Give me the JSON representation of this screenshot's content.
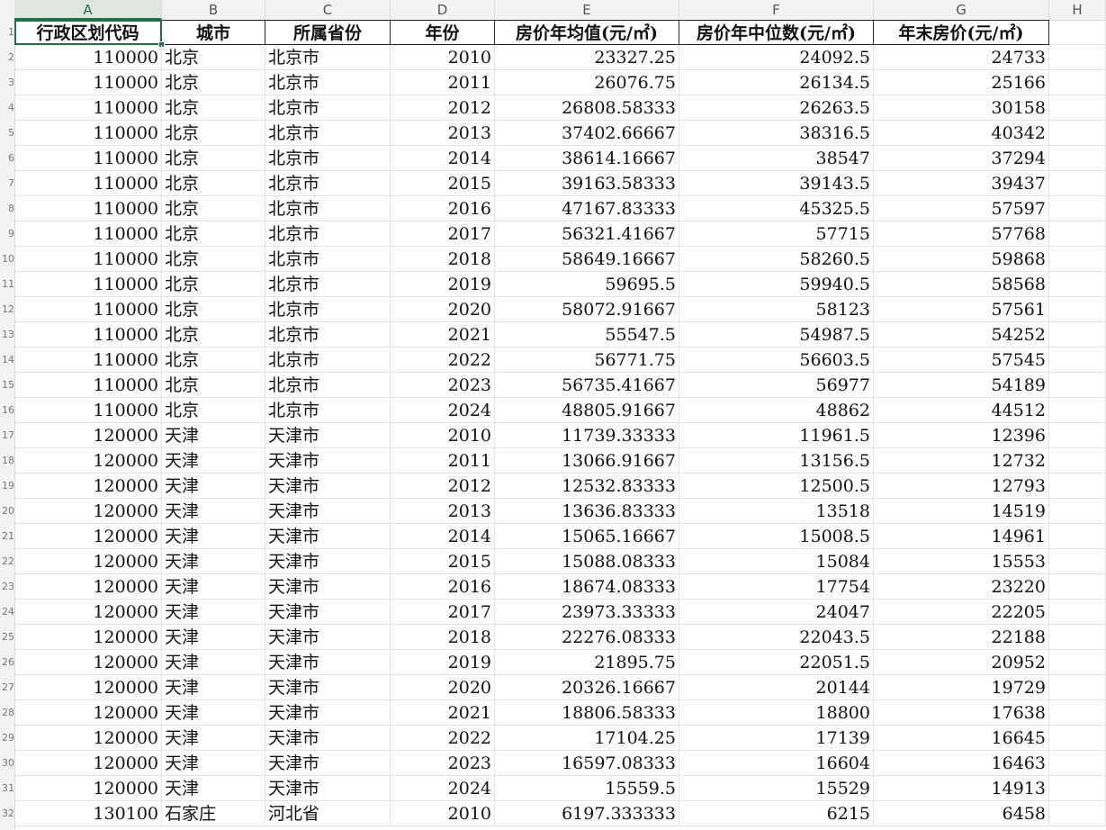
{
  "sheet": {
    "columns": [
      "A",
      "B",
      "C",
      "D",
      "E",
      "F",
      "G",
      "H"
    ],
    "selected_column": "A",
    "headers": [
      "行政区划代码",
      "城市",
      "所属省份",
      "年份",
      "房价年均值(元/㎡)",
      "房价年中位数(元/㎡)",
      "年末房价(元/㎡)"
    ],
    "row_numbers": [
      "1",
      "2",
      "3",
      "4",
      "5",
      "6",
      "7",
      "8",
      "9",
      "10",
      "11",
      "12",
      "13",
      "14",
      "15",
      "16",
      "17",
      "18",
      "19",
      "20",
      "21",
      "22",
      "23",
      "24",
      "25",
      "26",
      "27",
      "28",
      "29",
      "30",
      "31",
      "32"
    ],
    "rows": [
      [
        "110000",
        "北京",
        "北京市",
        "2010",
        "23327.25",
        "24092.5",
        "24733"
      ],
      [
        "110000",
        "北京",
        "北京市",
        "2011",
        "26076.75",
        "26134.5",
        "25166"
      ],
      [
        "110000",
        "北京",
        "北京市",
        "2012",
        "26808.58333",
        "26263.5",
        "30158"
      ],
      [
        "110000",
        "北京",
        "北京市",
        "2013",
        "37402.66667",
        "38316.5",
        "40342"
      ],
      [
        "110000",
        "北京",
        "北京市",
        "2014",
        "38614.16667",
        "38547",
        "37294"
      ],
      [
        "110000",
        "北京",
        "北京市",
        "2015",
        "39163.58333",
        "39143.5",
        "39437"
      ],
      [
        "110000",
        "北京",
        "北京市",
        "2016",
        "47167.83333",
        "45325.5",
        "57597"
      ],
      [
        "110000",
        "北京",
        "北京市",
        "2017",
        "56321.41667",
        "57715",
        "57768"
      ],
      [
        "110000",
        "北京",
        "北京市",
        "2018",
        "58649.16667",
        "58260.5",
        "59868"
      ],
      [
        "110000",
        "北京",
        "北京市",
        "2019",
        "59695.5",
        "59940.5",
        "58568"
      ],
      [
        "110000",
        "北京",
        "北京市",
        "2020",
        "58072.91667",
        "58123",
        "57561"
      ],
      [
        "110000",
        "北京",
        "北京市",
        "2021",
        "55547.5",
        "54987.5",
        "54252"
      ],
      [
        "110000",
        "北京",
        "北京市",
        "2022",
        "56771.75",
        "56603.5",
        "57545"
      ],
      [
        "110000",
        "北京",
        "北京市",
        "2023",
        "56735.41667",
        "56977",
        "54189"
      ],
      [
        "110000",
        "北京",
        "北京市",
        "2024",
        "48805.91667",
        "48862",
        "44512"
      ],
      [
        "120000",
        "天津",
        "天津市",
        "2010",
        "11739.33333",
        "11961.5",
        "12396"
      ],
      [
        "120000",
        "天津",
        "天津市",
        "2011",
        "13066.91667",
        "13156.5",
        "12732"
      ],
      [
        "120000",
        "天津",
        "天津市",
        "2012",
        "12532.83333",
        "12500.5",
        "12793"
      ],
      [
        "120000",
        "天津",
        "天津市",
        "2013",
        "13636.83333",
        "13518",
        "14519"
      ],
      [
        "120000",
        "天津",
        "天津市",
        "2014",
        "15065.16667",
        "15008.5",
        "14961"
      ],
      [
        "120000",
        "天津",
        "天津市",
        "2015",
        "15088.08333",
        "15084",
        "15553"
      ],
      [
        "120000",
        "天津",
        "天津市",
        "2016",
        "18674.08333",
        "17754",
        "23220"
      ],
      [
        "120000",
        "天津",
        "天津市",
        "2017",
        "23973.33333",
        "24047",
        "22205"
      ],
      [
        "120000",
        "天津",
        "天津市",
        "2018",
        "22276.08333",
        "22043.5",
        "22188"
      ],
      [
        "120000",
        "天津",
        "天津市",
        "2019",
        "21895.75",
        "22051.5",
        "20952"
      ],
      [
        "120000",
        "天津",
        "天津市",
        "2020",
        "20326.16667",
        "20144",
        "19729"
      ],
      [
        "120000",
        "天津",
        "天津市",
        "2021",
        "18806.58333",
        "18800",
        "17638"
      ],
      [
        "120000",
        "天津",
        "天津市",
        "2022",
        "17104.25",
        "17139",
        "16645"
      ],
      [
        "120000",
        "天津",
        "天津市",
        "2023",
        "16597.08333",
        "16604",
        "16463"
      ],
      [
        "120000",
        "天津",
        "天津市",
        "2024",
        "15559.5",
        "15529",
        "14913"
      ],
      [
        "130100",
        "石家庄",
        "河北省",
        "2010",
        "6197.333333",
        "6215",
        "6458"
      ]
    ],
    "accent_color": "#1e7145"
  }
}
